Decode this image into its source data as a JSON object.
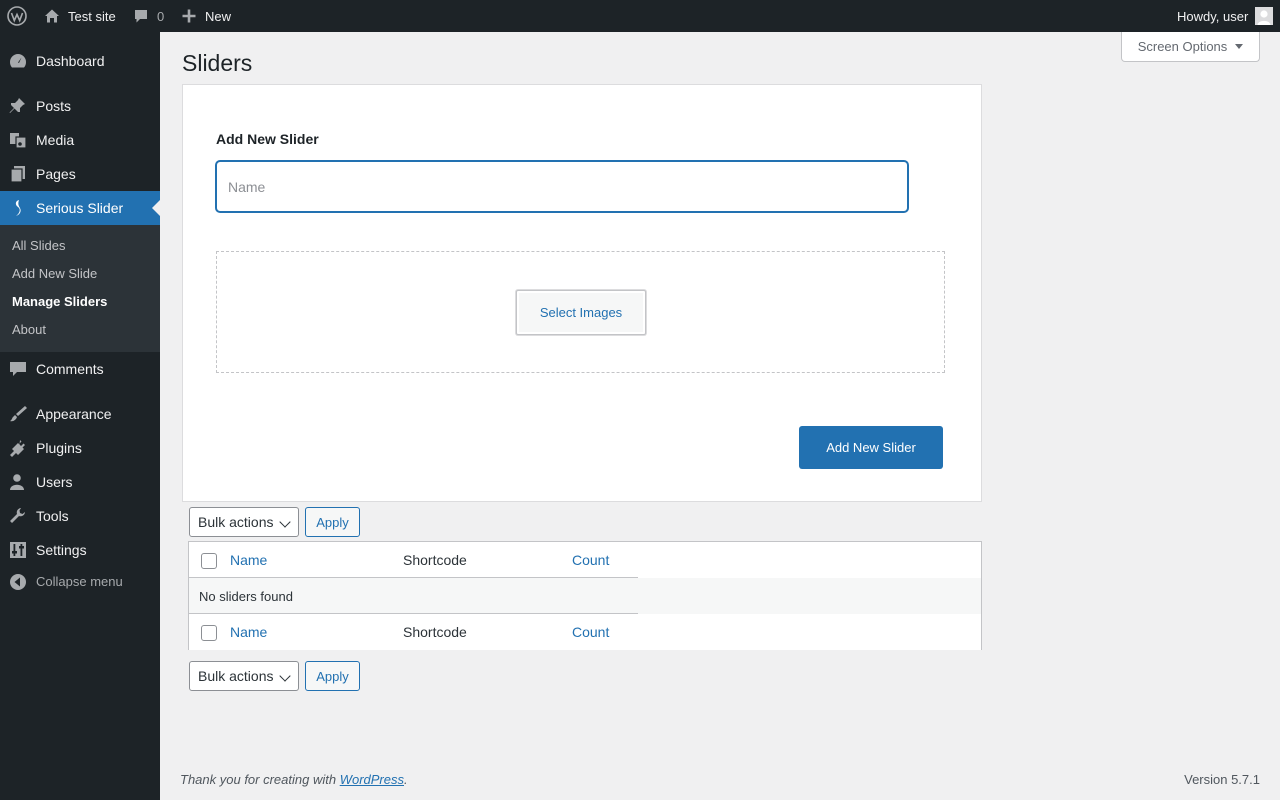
{
  "admin_bar": {
    "site_name": "Test site",
    "comments_count": "0",
    "new_label": "New",
    "greeting": "Howdy, user"
  },
  "sidebar": {
    "items": [
      {
        "label": "Dashboard",
        "icon": "dashboard-icon"
      },
      {
        "label": "Posts",
        "icon": "pushpin-icon"
      },
      {
        "label": "Media",
        "icon": "media-icon"
      },
      {
        "label": "Pages",
        "icon": "pages-icon"
      },
      {
        "label": "Serious Slider",
        "icon": "slider-icon",
        "current": true
      },
      {
        "label": "Comments",
        "icon": "comments-icon"
      },
      {
        "label": "Appearance",
        "icon": "appearance-icon"
      },
      {
        "label": "Plugins",
        "icon": "plugins-icon"
      },
      {
        "label": "Users",
        "icon": "users-icon"
      },
      {
        "label": "Tools",
        "icon": "tools-icon"
      },
      {
        "label": "Settings",
        "icon": "settings-icon"
      }
    ],
    "submenu": [
      "All Slides",
      "Add New Slide",
      "Manage Sliders",
      "About"
    ],
    "submenu_current": "Manage Sliders",
    "collapse_label": "Collapse menu"
  },
  "screen_options": "Screen Options",
  "page_title": "Sliders",
  "add_form": {
    "heading": "Add New Slider",
    "name_placeholder": "Name",
    "name_value": "",
    "select_images_label": "Select Images",
    "submit_label": "Add New Slider"
  },
  "table": {
    "bulk_actions": "Bulk actions",
    "apply_label": "Apply",
    "columns": [
      "Name",
      "Shortcode",
      "Count"
    ],
    "empty_message": "No sliders found"
  },
  "footer": {
    "thanks_prefix": "Thank you for creating with ",
    "thanks_link": "WordPress",
    "thanks_suffix": ".",
    "version": "Version 5.7.1"
  },
  "colors": {
    "sidebar_bg": "#1d2327",
    "accent": "#2271b1",
    "page_bg": "#f0f0f1"
  }
}
